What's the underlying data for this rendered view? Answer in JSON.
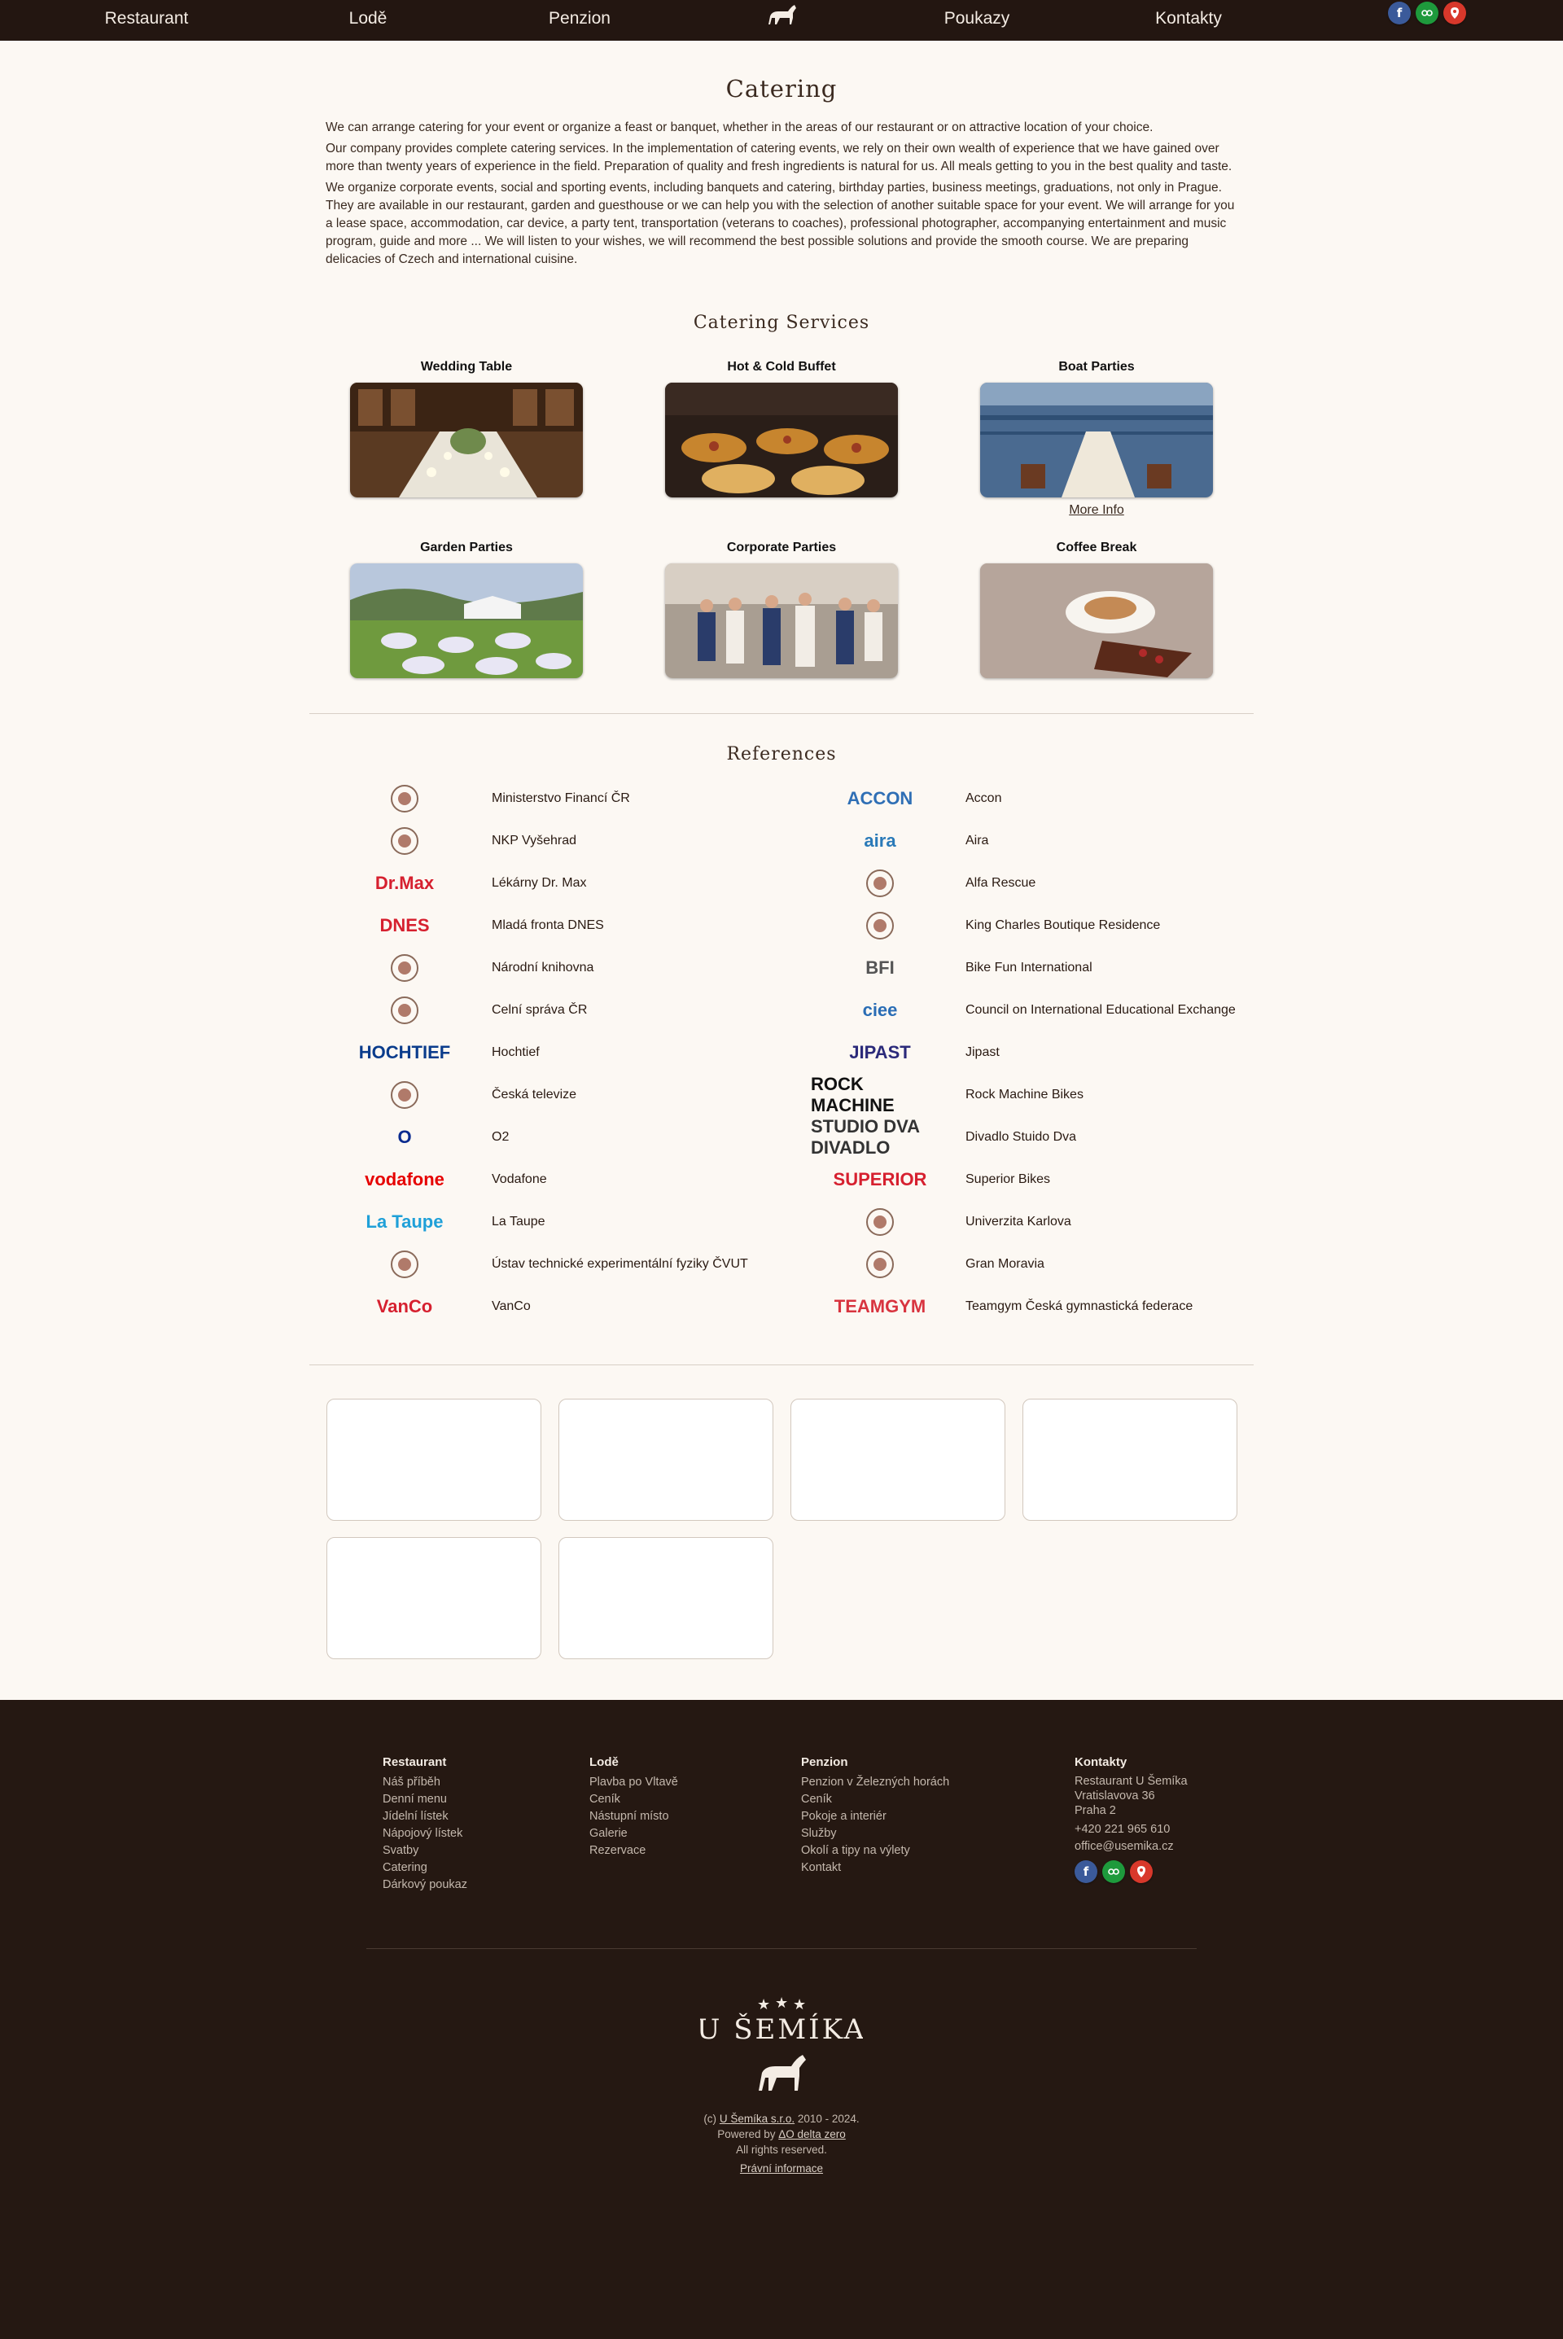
{
  "nav": {
    "items": [
      "Restaurant",
      "Lodě",
      "Penzion",
      "Poukazy",
      "Kontakty"
    ]
  },
  "page_title": "Catering",
  "intro": [
    "We can arrange catering for your event or organize a feast or banquet, whether in the areas of our restaurant or on attractive location of your choice.",
    "Our company provides complete catering services. In the implementation of catering events, we rely on their own wealth of experience that we have gained over more than twenty years of experience in the field. Preparation of quality and fresh ingredients is natural for us. All meals getting to you in the best quality and taste.",
    "We organize corporate events, social and sporting events, including banquets and catering, birthday parties, business meetings, graduations, not only in Prague. They are available in our restaurant, garden and guesthouse or we can help you with the selection of another suitable space for your event. We will arrange for you a lease space, accommodation, car device, a party tent, transportation (veterans to coaches), professional photographer, accompanying entertainment and music program, guide and more ... We will listen to your wishes, we will recommend the best possible solutions and provide the smooth course. We are preparing delicacies of Czech and international cuisine."
  ],
  "services_title": "Catering Services",
  "services": [
    {
      "title": "Wedding Table"
    },
    {
      "title": "Hot & Cold Buffet"
    },
    {
      "title": "Boat Parties"
    },
    {
      "title": "Garden Parties"
    },
    {
      "title": "Corporate Parties"
    },
    {
      "title": "Coffee Break"
    }
  ],
  "more_info": "More Info",
  "references_title": "References",
  "references_left": [
    {
      "name": "Ministerstvo Financí ČR",
      "icon": "ministry-emblem-icon"
    },
    {
      "name": "NKP Vyšehrad",
      "icon": "vysehrad-icon"
    },
    {
      "name": "Lékárny Dr. Max",
      "logo_text": "Dr.Max",
      "color": "#d6202f"
    },
    {
      "name": "Mladá fronta DNES",
      "logo_text": "DNES",
      "color": "#d6202f"
    },
    {
      "name": "Národní knihovna",
      "icon": "nk-logo-icon"
    },
    {
      "name": "Celní správa ČR",
      "icon": "customs-emblem-icon"
    },
    {
      "name": "Hochtief",
      "logo_text": "HOCHTIEF",
      "color": "#0a3c8c"
    },
    {
      "name": "Česká televize",
      "icon": "ct-logo-icon"
    },
    {
      "name": "O2",
      "logo_text": "O",
      "color": "#0a2b8f"
    },
    {
      "name": "Vodafone",
      "logo_text": "vodafone",
      "color": "#e60000"
    },
    {
      "name": "La Taupe",
      "logo_text": "La Taupe",
      "color": "#1fa0d8"
    },
    {
      "name": "Ústav technické experimentální fyziky ČVUT",
      "icon": "utef-logo-icon"
    },
    {
      "name": "VanCo",
      "logo_text": "VanCo",
      "color": "#d6202f"
    }
  ],
  "references_right": [
    {
      "name": "Accon",
      "logo_text": "ACCON",
      "color": "#2f6fb5"
    },
    {
      "name": "Aira",
      "logo_text": "aira",
      "color": "#2a7ab8"
    },
    {
      "name": "Alfa Rescue",
      "icon": "alfa-rescue-icon"
    },
    {
      "name": "King Charles Boutique Residence",
      "icon": "crest-icon"
    },
    {
      "name": "Bike Fun International",
      "logo_text": "BFI",
      "color": "#555"
    },
    {
      "name": "Council on International Educational Exchange",
      "logo_text": "ciee",
      "color": "#2a6db5"
    },
    {
      "name": "Jipast",
      "logo_text": "JIPAST",
      "color": "#2b2a7a"
    },
    {
      "name": "Rock Machine Bikes",
      "logo_text": "ROCK MACHINE",
      "color": "#111"
    },
    {
      "name": "Divadlo Stuido Dva",
      "logo_text": "STUDIO DVA DIVADLO",
      "color": "#333"
    },
    {
      "name": "Superior Bikes",
      "logo_text": "SUPERIOR",
      "color": "#d6202f"
    },
    {
      "name": "Univerzita Karlova",
      "icon": "charles-university-seal-icon"
    },
    {
      "name": "Gran Moravia",
      "icon": "gran-moravia-icon"
    },
    {
      "name": "Teamgym Česká gymnastická federace",
      "logo_text": "TEAMGYM",
      "color": "#d8343f"
    }
  ],
  "footer": {
    "columns": [
      {
        "heading": "Restaurant",
        "links": [
          "Náš příběh",
          "Denní menu",
          "Jídelní lístek",
          "Nápojový lístek",
          "Svatby",
          "Catering",
          "Dárkový poukaz"
        ]
      },
      {
        "heading": "Lodě",
        "links": [
          "Plavba po Vltavě",
          "Ceník",
          "Nástupní místo",
          "Galerie",
          "Rezervace"
        ]
      },
      {
        "heading": "Penzion",
        "links": [
          "Penzion v Železných horách",
          "Ceník",
          "Pokoje a interiér",
          "Služby",
          "Okolí a tipy na výlety",
          "Kontakt"
        ]
      },
      {
        "heading": "Kontakty",
        "links": [
          "Restaurant U Šemíka",
          "Vratislavova 36",
          "Praha 2",
          "+420 221 965 610",
          "office@usemika.cz"
        ]
      }
    ],
    "logo_text": "U ŠEMÍKA",
    "copy_prefix": "(c) ",
    "company": "U Šemíka s.r.o.",
    "years": " 2010 - 2024.",
    "powered_prefix": "Powered by ",
    "powered_by": "ΔO delta zero",
    "rights": "All rights reserved.",
    "legal": "Právní informace"
  }
}
